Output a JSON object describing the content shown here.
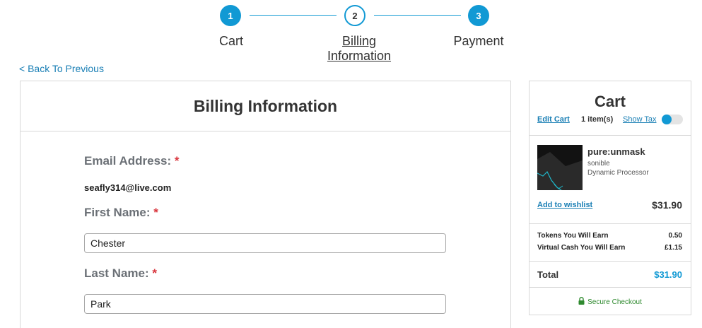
{
  "stepper": {
    "steps": [
      {
        "number": "1",
        "label": "Cart"
      },
      {
        "number": "2",
        "label_line1": "Billing",
        "label_line2": "Information"
      },
      {
        "number": "3",
        "label": "Payment"
      }
    ],
    "accent_color": "#1199d4"
  },
  "back_link": "< Back To Previous",
  "billing": {
    "title": "Billing Information",
    "required_mark": "*",
    "email_label": "Email Address:",
    "email_value": "seafly314@live.com",
    "first_name_label": "First Name:",
    "first_name_value": "Chester",
    "last_name_label": "Last Name:",
    "last_name_value": "Park"
  },
  "cart": {
    "title": "Cart",
    "edit_cart": "Edit Cart",
    "item_count": "1 item(s)",
    "show_tax": "Show Tax",
    "show_tax_toggle": "off",
    "product": {
      "name": "pure:unmask",
      "brand": "sonible",
      "description": "Dynamic Processor",
      "thumbnail_icon": "product-thumbnail"
    },
    "add_to_wishlist": "Add to wishlist",
    "item_price": "$31.90",
    "tokens_label": "Tokens You Will Earn",
    "tokens_value": "0.50",
    "virtual_cash_label": "Virtual Cash You Will Earn",
    "virtual_cash_value": "£1.15",
    "total_label": "Total",
    "total_value": "$31.90",
    "secure_checkout": "Secure Checkout",
    "secure_icon": "lock-icon",
    "secure_color": "#2f8a2f"
  }
}
